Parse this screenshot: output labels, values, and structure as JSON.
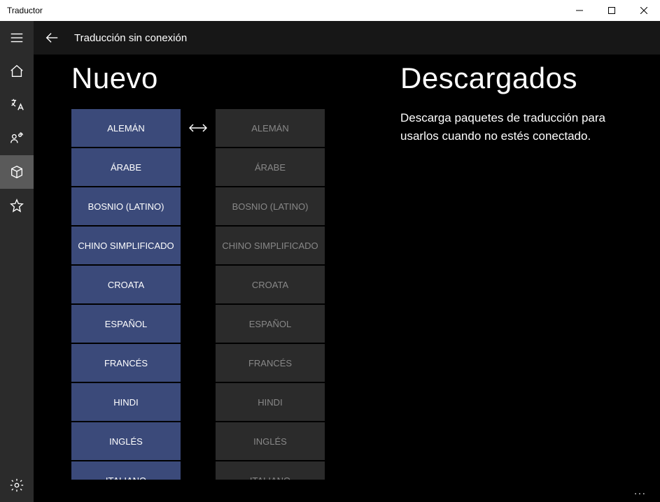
{
  "window": {
    "title": "Traductor"
  },
  "topbar": {
    "page_title": "Traducción sin conexión"
  },
  "sections": {
    "new": "Nuevo",
    "downloaded": "Descargados",
    "desc": "Descarga paquetes de traducción para usarlos cuando no estés conectado."
  },
  "languages_from": [
    "ALEMÁN",
    "ÁRABE",
    "BOSNIO (LATINO)",
    "CHINO SIMPLIFICADO",
    "CROATA",
    "ESPAÑOL",
    "FRANCÉS",
    "HINDI",
    "INGLÉS",
    "ITALIANO"
  ],
  "languages_to": [
    "ALEMÁN",
    "ÁRABE",
    "BOSNIO (LATINO)",
    "CHINO SIMPLIFICADO",
    "CROATA",
    "ESPAÑOL",
    "FRANCÉS",
    "HINDI",
    "INGLÉS",
    "ITALIANO"
  ],
  "more": "..."
}
